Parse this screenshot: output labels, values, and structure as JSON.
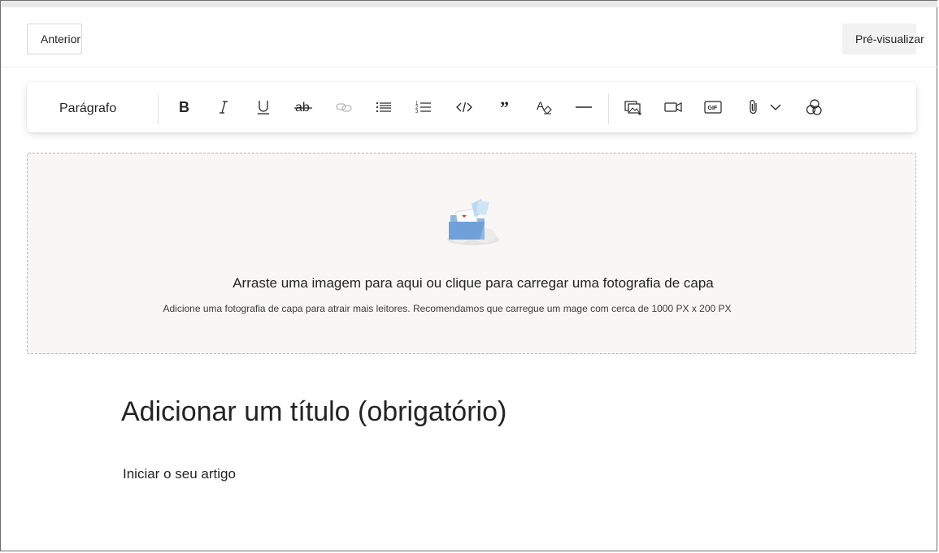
{
  "header": {
    "previous_label": "Anterior",
    "preview_label": "Pré-visualizar"
  },
  "toolbar": {
    "paragraph_style": "Parágrafo",
    "buttons": [
      "bold-icon",
      "italic-icon",
      "underline-icon",
      "strikethrough-icon",
      "link-icon",
      "bulleted-list-icon",
      "numbered-list-icon",
      "code-icon",
      "quote-icon",
      "clear-formatting-icon",
      "horizontal-rule-icon",
      "image-icon",
      "video-icon",
      "gif-icon",
      "attachment-icon",
      "chevron-down-icon",
      "more-icon"
    ]
  },
  "cover": {
    "main_text": "Arraste uma imagem para aqui ou clique para carregar uma fotografia de capa",
    "sub_text": "Adicione uma fotografia de capa para atrair mais leitores. Recomendamos que carregue um mage com cerca de 1000 PX x 200 PX",
    "illustration": "folder-cloud-illustration"
  },
  "article": {
    "title_placeholder": "Adicionar um título (obrigatório)",
    "body_placeholder": "Iniciar o seu artigo"
  },
  "colors": {
    "dropzone_bg": "#f8f7f6",
    "text": "#242424",
    "border": "#d6d6d6"
  }
}
